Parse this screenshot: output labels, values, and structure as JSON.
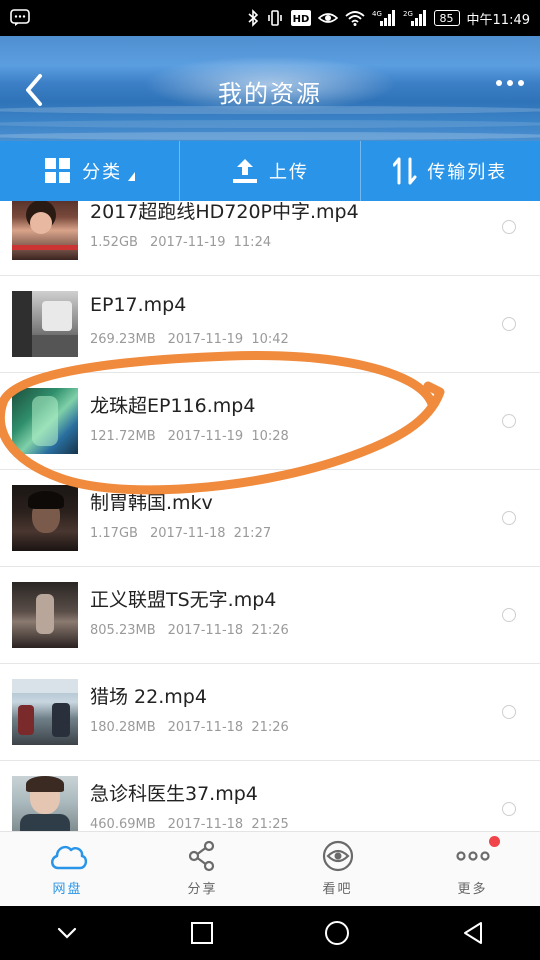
{
  "status_bar": {
    "network_4g": "4G",
    "network_2g": "2G",
    "battery": "85",
    "time": "中午11:49"
  },
  "header": {
    "title": "我的资源"
  },
  "toolbar": {
    "category_label": "分类",
    "upload_label": "上传",
    "transfer_label": "传输列表"
  },
  "files": [
    {
      "name": "2017超跑线HD720P中字.mp4",
      "size": "1.52GB",
      "date": "2017-11-19",
      "time": "11:24"
    },
    {
      "name": "EP17.mp4",
      "size": "269.23MB",
      "date": "2017-11-19",
      "time": "10:42"
    },
    {
      "name": "龙珠超EP116.mp4",
      "size": "121.72MB",
      "date": "2017-11-19",
      "time": "10:28"
    },
    {
      "name": "制胃韩国.mkv",
      "size": "1.17GB",
      "date": "2017-11-18",
      "time": "21:27"
    },
    {
      "name": "正义联盟TS无字.mp4",
      "size": "805.23MB",
      "date": "2017-11-18",
      "time": "21:26"
    },
    {
      "name": "猎场 22.mp4",
      "size": "180.28MB",
      "date": "2017-11-18",
      "time": "21:26"
    },
    {
      "name": "急诊科医生37.mp4",
      "size": "460.69MB",
      "date": "2017-11-18",
      "time": "21:25"
    }
  ],
  "bottom_nav": {
    "items": [
      {
        "label": "网盘",
        "icon": "cloud-icon",
        "active": true
      },
      {
        "label": "分享",
        "icon": "share-icon",
        "active": false
      },
      {
        "label": "看吧",
        "icon": "eye-icon",
        "active": false
      },
      {
        "label": "更多",
        "icon": "more-dots-icon",
        "active": false
      }
    ]
  },
  "colors": {
    "accent": "#2a95e8",
    "annotation": "#f08a3c",
    "badge": "#f0434a"
  }
}
